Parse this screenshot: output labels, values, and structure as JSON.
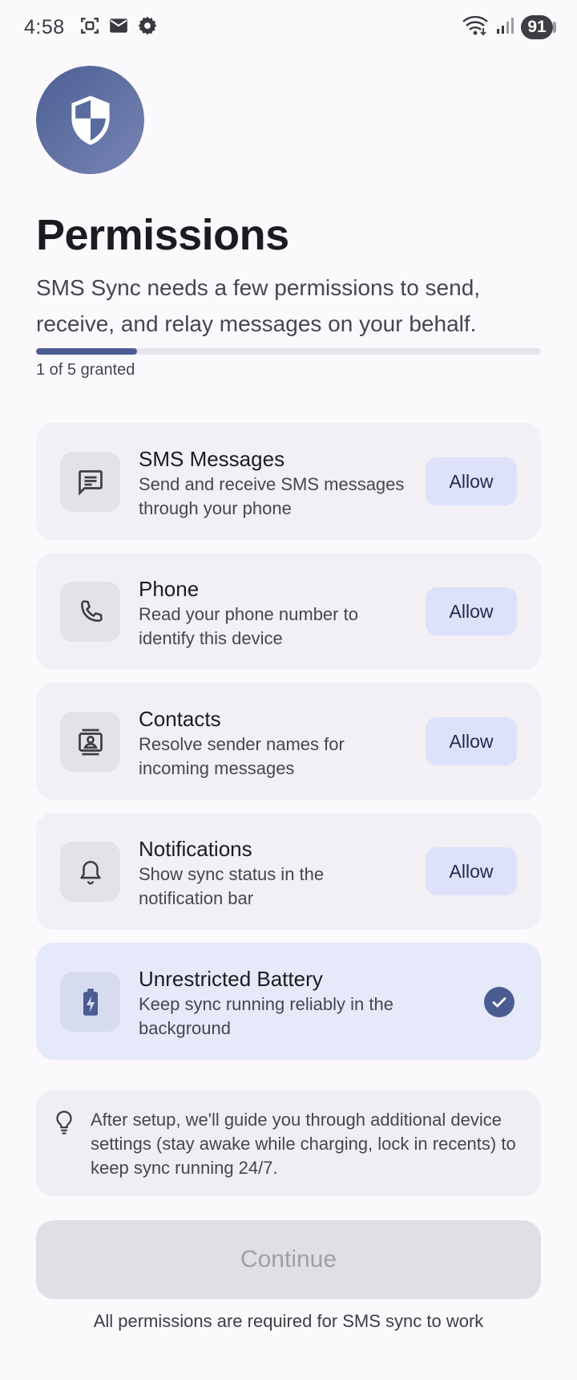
{
  "status_bar": {
    "time": "4:58",
    "battery": "91",
    "icons": [
      "screenshot-icon",
      "mail-icon",
      "settings-icon",
      "wifi-icon",
      "signal-icon"
    ]
  },
  "header": {
    "icon": "shield-icon",
    "title": "Permissions",
    "subtitle": "SMS Sync needs a few permissions to send, receive, and relay messages on your behalf."
  },
  "progress": {
    "granted": 1,
    "total": 5,
    "fraction": 0.2,
    "label": "1 of 5 granted"
  },
  "permissions": [
    {
      "title": "SMS Messages",
      "description": "Send and receive SMS messages through your phone",
      "icon": "message-icon",
      "action": "Allow",
      "granted": false
    },
    {
      "title": "Phone",
      "description": "Read your phone number to identify this device",
      "icon": "phone-icon",
      "action": "Allow",
      "granted": false
    },
    {
      "title": "Contacts",
      "description": "Resolve sender names for incoming messages",
      "icon": "contacts-icon",
      "action": "Allow",
      "granted": false
    },
    {
      "title": "Notifications",
      "description": "Show sync status in the notification bar",
      "icon": "bell-icon",
      "action": "Allow",
      "granted": false
    },
    {
      "title": "Unrestricted Battery",
      "description": "Keep sync running reliably in the background",
      "icon": "battery-bolt-icon",
      "action": "",
      "granted": true
    }
  ],
  "tip": {
    "icon": "lightbulb-icon",
    "text": "After setup, we'll guide you through additional device settings (stay awake while charging, lock in recents) to keep sync running 24/7."
  },
  "continue_button": {
    "label": "Continue",
    "enabled": false
  },
  "footer_note": "All permissions are required for SMS sync to work",
  "colors": {
    "accent": "#4b5c92",
    "card": "#f2f0f5",
    "granted_card": "#e6e9fa",
    "allow_button": "#dde1f9",
    "disabled_button": "#e0dfe4"
  }
}
